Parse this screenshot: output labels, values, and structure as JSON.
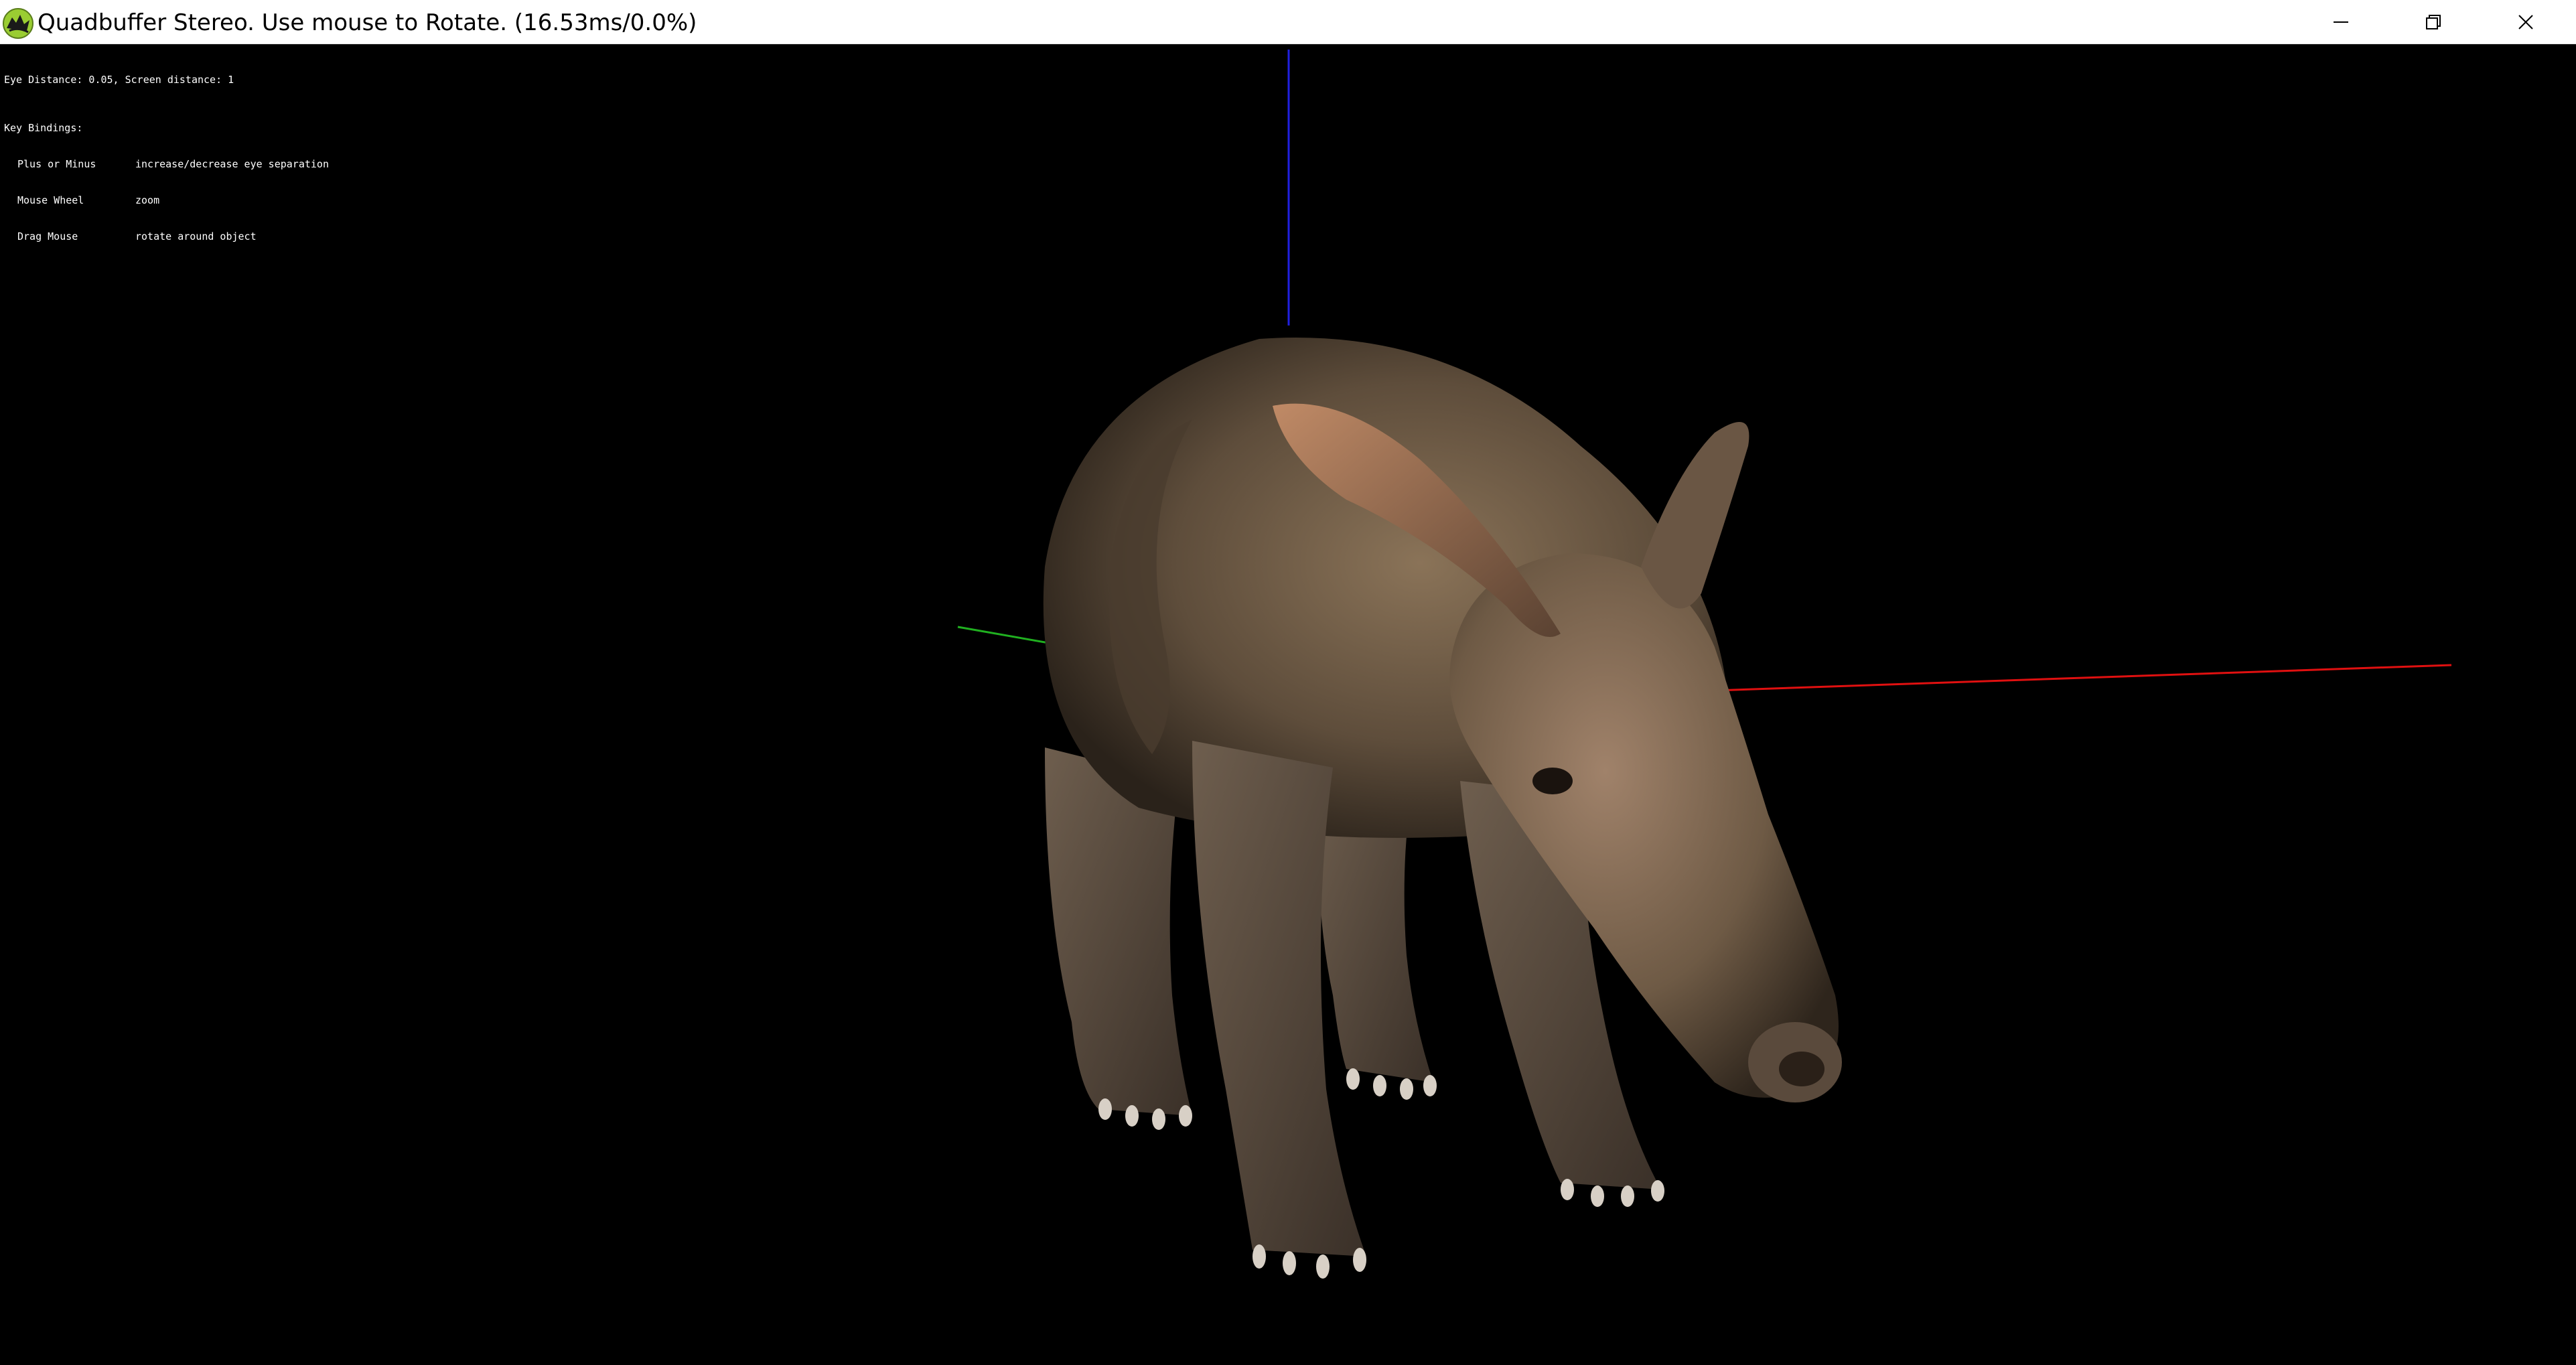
{
  "window": {
    "title": "Quadbuffer Stereo. Use mouse to Rotate. (16.53ms/0.0%)",
    "icon": "osg-app-icon",
    "controls": {
      "minimize_icon": "minimize-icon",
      "restore_icon": "restore-icon",
      "close_icon": "close-icon"
    }
  },
  "hud": {
    "status": "Eye Distance: 0.05, Screen distance: 1",
    "key_bindings_header": "Key Bindings:",
    "bindings": [
      {
        "key": "Plus or Minus",
        "action": "increase/decrease eye separation"
      },
      {
        "key": "Mouse Wheel",
        "action": "zoom"
      },
      {
        "key": "Drag Mouse",
        "action": "rotate around object"
      }
    ]
  },
  "scene": {
    "model": "aardvark",
    "axis_colors": {
      "x": "#e01010",
      "y": "#20b020",
      "z": "#2020e0"
    },
    "background": "#000000"
  }
}
